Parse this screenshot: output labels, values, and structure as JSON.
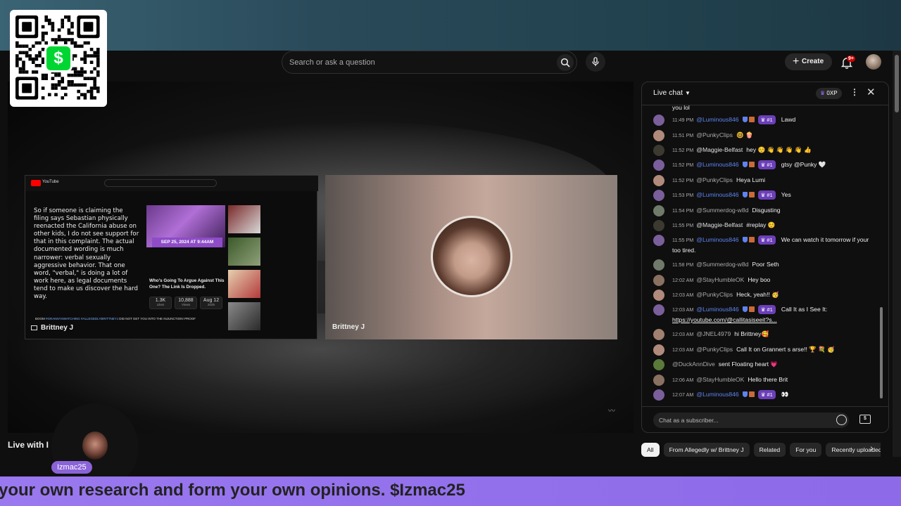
{
  "header": {
    "search_placeholder": "Search or ask a question",
    "create_label": "Create",
    "notification_count": "9+"
  },
  "qr": {
    "cash_symbol": "$",
    "color": "#00d632"
  },
  "player": {
    "left_panel": {
      "body_text": "So if someone is claiming the filing says Sebastian physically reenacted the California abuse on other kids, I do not see support for that in this complaint. The actual documented wording is much narrower: verbal sexually aggressive behavior. That one word, \"verbal,\" is doing a lot of work here, as legal documents tend to make us discover the hard way.",
      "date_badge": "SEP 25, 2024 AT 9:44AM",
      "headline": "Who's Going To Argue Against This One? The Link Is Dropped.",
      "stats": [
        {
          "value": "1.3K",
          "label": "Likes"
        },
        {
          "value": "10,888",
          "label": "Views"
        },
        {
          "value": "Aug 12",
          "label": "2025"
        }
      ],
      "boom_prefix": "BOOM ",
      "boom_tags": "#GRANNYSWATCHING #ALLEGEDLYBRITTNEYJ",
      "boom_suffix": " DID NOT GET YOU INTO THE INJUNCTION! PROOF",
      "name": "Brittney J"
    },
    "right_panel": {
      "name": "Brittney J"
    }
  },
  "below_player": {
    "title": "Live with I",
    "overlay_username": "Izmac25"
  },
  "ticker": {
    "text": "your own research and form your own opinions. $Izmac25"
  },
  "chat": {
    "title": "Live chat",
    "xp": "0XP",
    "input_placeholder": "Chat as a subscriber...",
    "messages": [
      {
        "time": "",
        "author": "",
        "text": "you lol",
        "mod": false
      },
      {
        "time": "11:49 PM",
        "author": "@Luminous846",
        "text": "Lawd",
        "mod": true,
        "rank": "#1"
      },
      {
        "time": "11:51 PM",
        "author": "@PunkyClips",
        "text": "🤓 🍿",
        "mod": false
      },
      {
        "time": "11:52 PM",
        "author": "@Maggie-Belfast",
        "text": "hey ☺️ 👋 👋 👋 👋 👍",
        "mod": false,
        "strong": true
      },
      {
        "time": "11:52 PM",
        "author": "@Luminous846",
        "text": "gtsy @Punky 🤍",
        "mod": true,
        "rank": "#1"
      },
      {
        "time": "11:52 PM",
        "author": "@PunkyClips",
        "text": "Heya Lumi",
        "mod": false
      },
      {
        "time": "11:53 PM",
        "author": "@Luminous846",
        "text": "Yes",
        "mod": true,
        "rank": "#1"
      },
      {
        "time": "11:54 PM",
        "author": "@Summerdog-w8d",
        "text": "Disgusting",
        "mod": false
      },
      {
        "time": "11:55 PM",
        "author": "@Maggie-Belfast",
        "text": "#replay ☺️",
        "mod": false,
        "strong": true
      },
      {
        "time": "11:55 PM",
        "author": "@Luminous846",
        "text": "We can watch it tomorrow if your too tired.",
        "mod": true,
        "rank": "#1"
      },
      {
        "time": "11:58 PM",
        "author": "@Summerdog-w8d",
        "text": "Poor Seth",
        "mod": false
      },
      {
        "time": "12:02 AM",
        "author": "@StayHumbleOK",
        "text": "Hey boo",
        "mod": false
      },
      {
        "time": "12:03 AM",
        "author": "@PunkyClips",
        "text": "Heck, yeah!! 🥳",
        "mod": false
      },
      {
        "time": "12:03 AM",
        "author": "@Luminous846",
        "text": "Call It as I See It:",
        "link": "https://youtube.com/@callitasiseeit?s...",
        "mod": true,
        "rank": "#1"
      },
      {
        "time": "12:03 AM",
        "author": "@JNEL4979",
        "text": "hi Brittney🥰",
        "mod": false
      },
      {
        "time": "12:03 AM",
        "author": "@PunkyClips",
        "text": "Call It on Grannert s arse!! 🏆 💐 🥳",
        "mod": false
      },
      {
        "time": "",
        "author": "@DuckAnnDive",
        "text": "sent Floating heart 💗",
        "mod": false
      },
      {
        "time": "12:06 AM",
        "author": "@StayHumbleOK",
        "text": "Hello there Brit",
        "mod": false
      },
      {
        "time": "12:07 AM",
        "author": "@Luminous846",
        "text": "👀",
        "mod": true,
        "rank": "#1"
      }
    ]
  },
  "chips": [
    "All",
    "From Allegedly w/ Brittney J",
    "Related",
    "For you",
    "Recently uploaded"
  ]
}
